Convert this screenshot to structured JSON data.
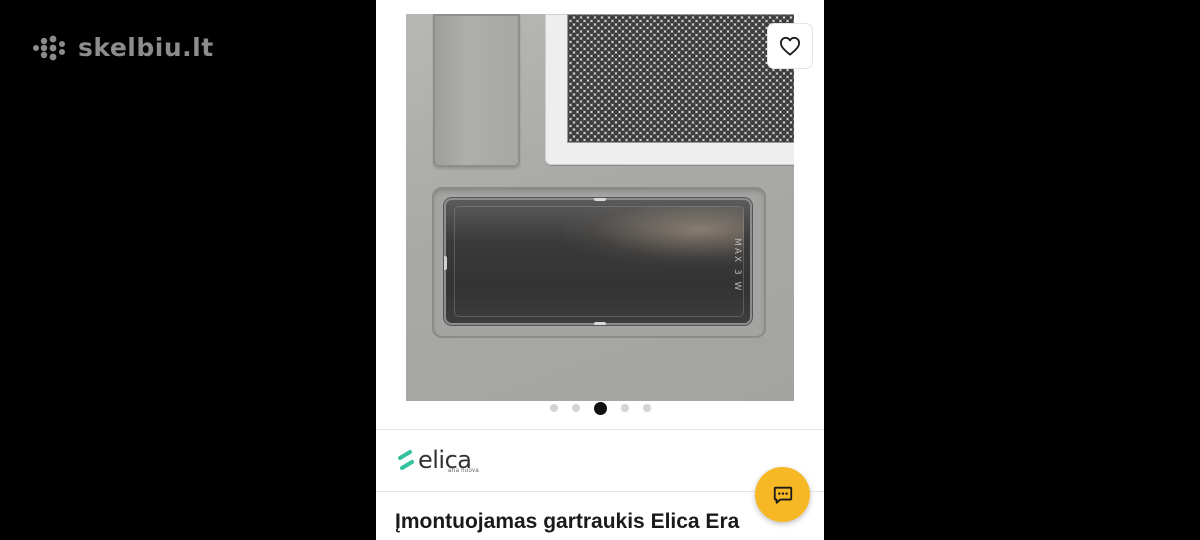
{
  "site": {
    "logo_text": "skelbiu.lt"
  },
  "gallery": {
    "photo_label": "MAX 3 W",
    "slide_count": 5,
    "active_slide": 3,
    "favorite_icon": "heart-outline-icon"
  },
  "seller": {
    "brand_name": "elica",
    "brand_tagline": "aria nuova"
  },
  "listing": {
    "title": "Įmontuojamas gartraukis Elica Era"
  },
  "actions": {
    "chat_icon": "chat-bubble-icon"
  },
  "colors": {
    "background": "#000000",
    "panel": "#ffffff",
    "chat_button": "#f7b825",
    "active_dot": "#111111",
    "inactive_dot": "#d3d3d3",
    "brand_accent": "#35c1a0"
  }
}
